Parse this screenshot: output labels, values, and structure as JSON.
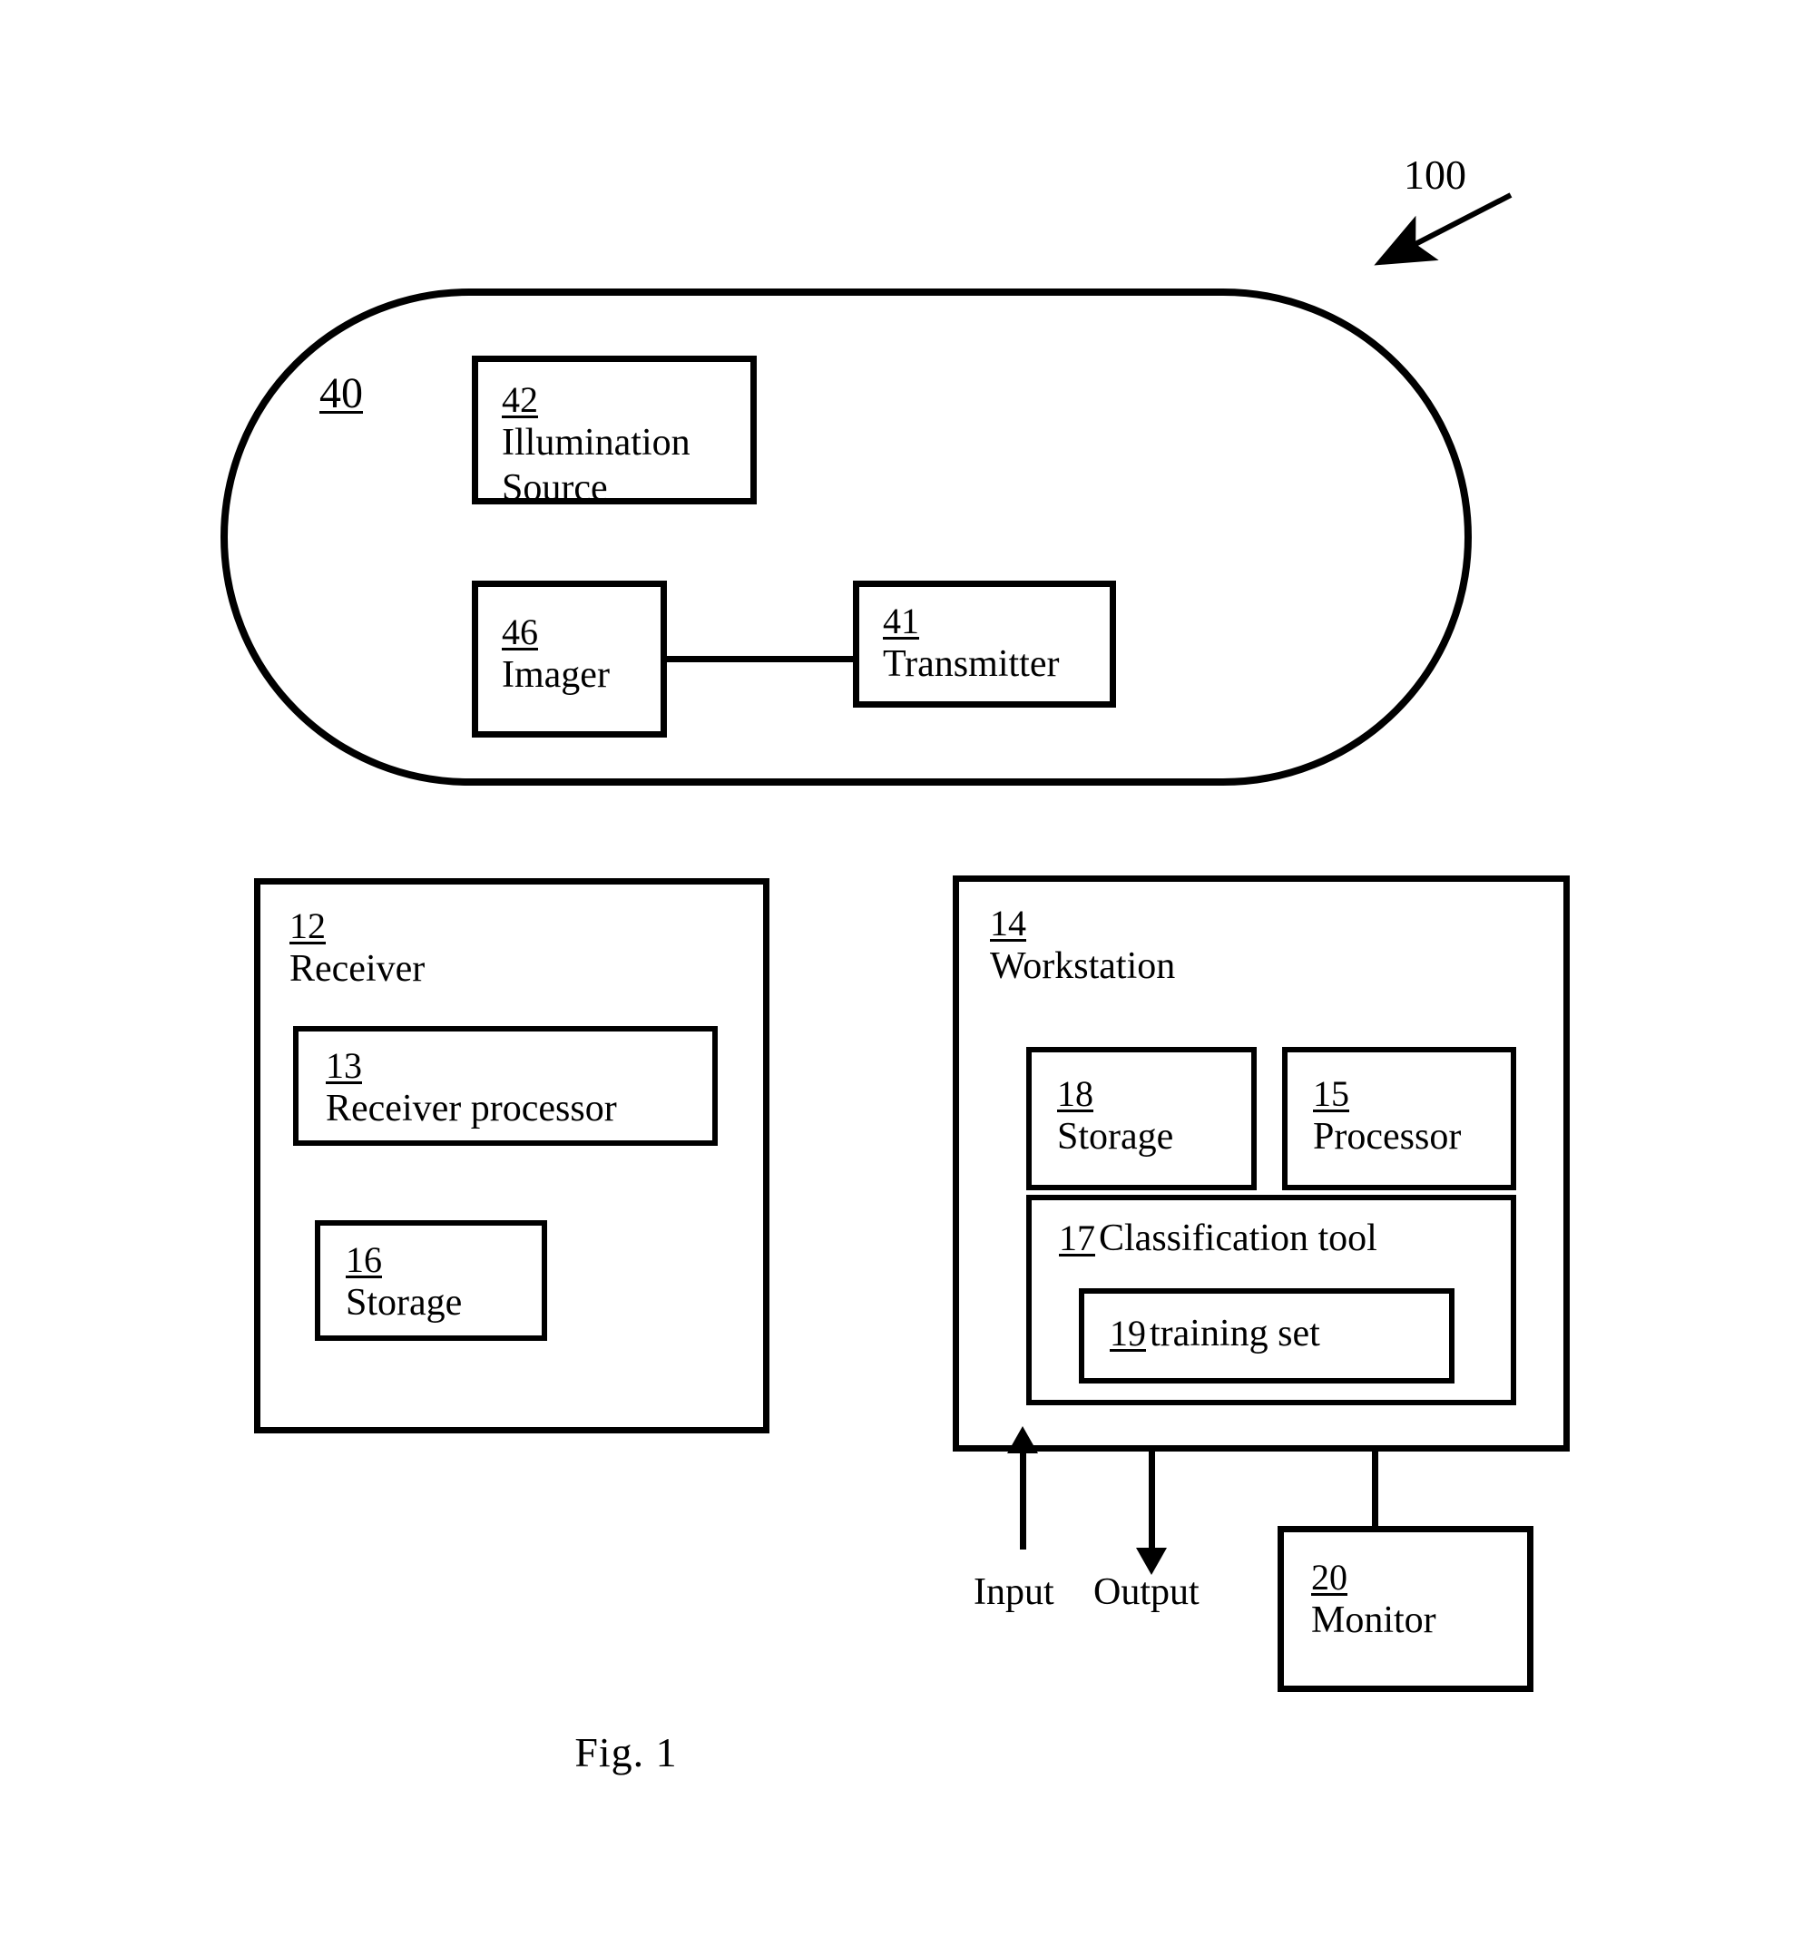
{
  "figure": {
    "caption": "Fig. 1",
    "system_numeral": "100"
  },
  "capsule": {
    "numeral": "40",
    "components": [
      {
        "numeral": "42",
        "label_line1": "Illumination",
        "label_line2": "Source",
        "name": "illumination-source"
      },
      {
        "numeral": "46",
        "label_line1": "Imager",
        "label_line2": "",
        "name": "imager"
      },
      {
        "numeral": "41",
        "label_line1": "Transmitter",
        "label_line2": "",
        "name": "transmitter"
      }
    ]
  },
  "receiver": {
    "numeral": "12",
    "label": "Receiver",
    "children": [
      {
        "numeral": "13",
        "label": "Receiver processor",
        "name": "receiver-processor"
      },
      {
        "numeral": "16",
        "label": "Storage",
        "name": "receiver-storage"
      }
    ]
  },
  "workstation": {
    "numeral": "14",
    "label": "Workstation",
    "children": [
      {
        "numeral": "18",
        "label": "Storage",
        "name": "workstation-storage"
      },
      {
        "numeral": "15",
        "label": "Processor",
        "name": "workstation-processor"
      },
      {
        "numeral": "17",
        "label": "Classification tool",
        "name": "classification-tool"
      },
      {
        "numeral": "19",
        "label": "training set",
        "name": "training-set"
      }
    ],
    "io": {
      "input_label": "Input",
      "output_label": "Output"
    }
  },
  "monitor": {
    "numeral": "20",
    "label": "Monitor"
  },
  "colors": {
    "stroke": "#000000",
    "background": "#ffffff"
  }
}
